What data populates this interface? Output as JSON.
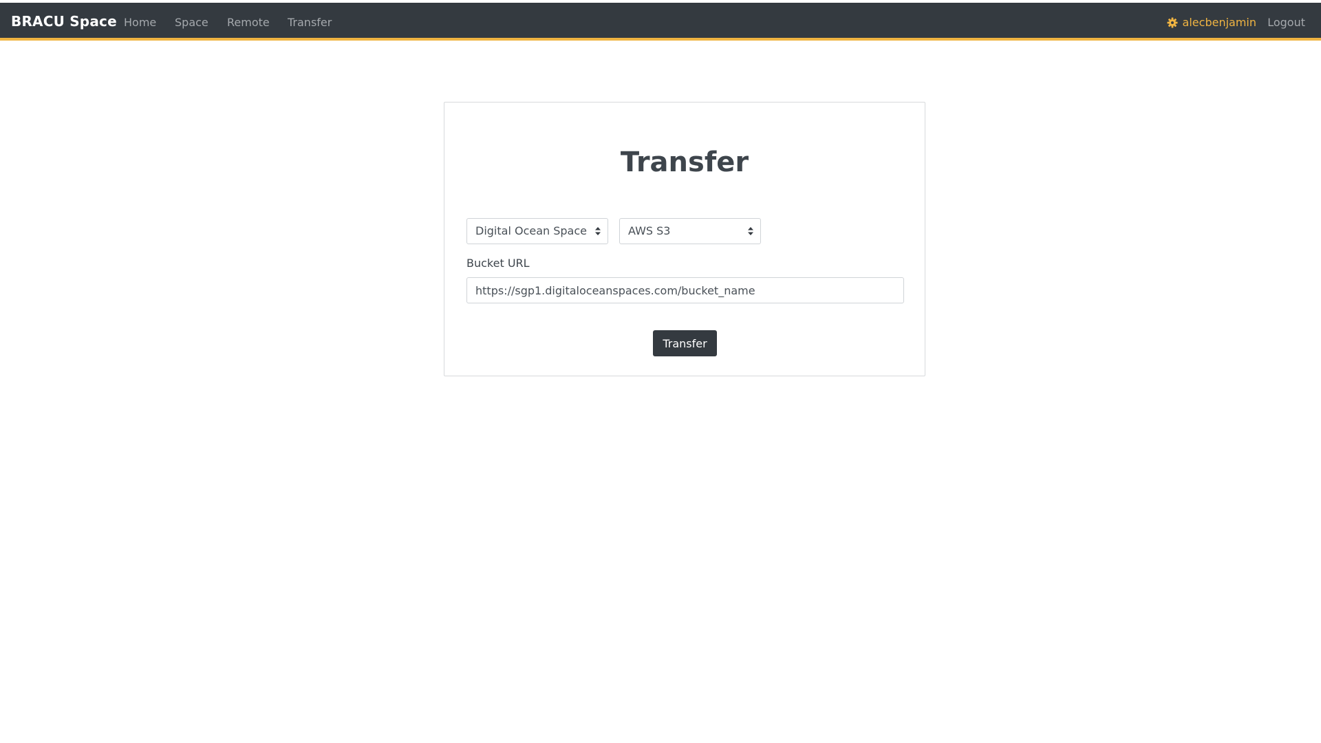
{
  "navbar": {
    "brand": "BRACU Space",
    "links": [
      "Home",
      "Space",
      "Remote",
      "Transfer"
    ],
    "user": {
      "name": "alecbenjamin",
      "icon": "gear-icon"
    },
    "logout": "Logout"
  },
  "transfer_card": {
    "title": "Transfer",
    "source_select": {
      "selected": "Digital Ocean Space"
    },
    "destination_select": {
      "selected": "AWS S3"
    },
    "bucket_url_label": "Bucket URL",
    "bucket_url_value": "https://sgp1.digitaloceanspaces.com/bucket_name",
    "submit_label": "Transfer"
  },
  "colors": {
    "navbar_bg": "#343a40",
    "accent": "#f0b442",
    "button_bg": "#343a40"
  }
}
